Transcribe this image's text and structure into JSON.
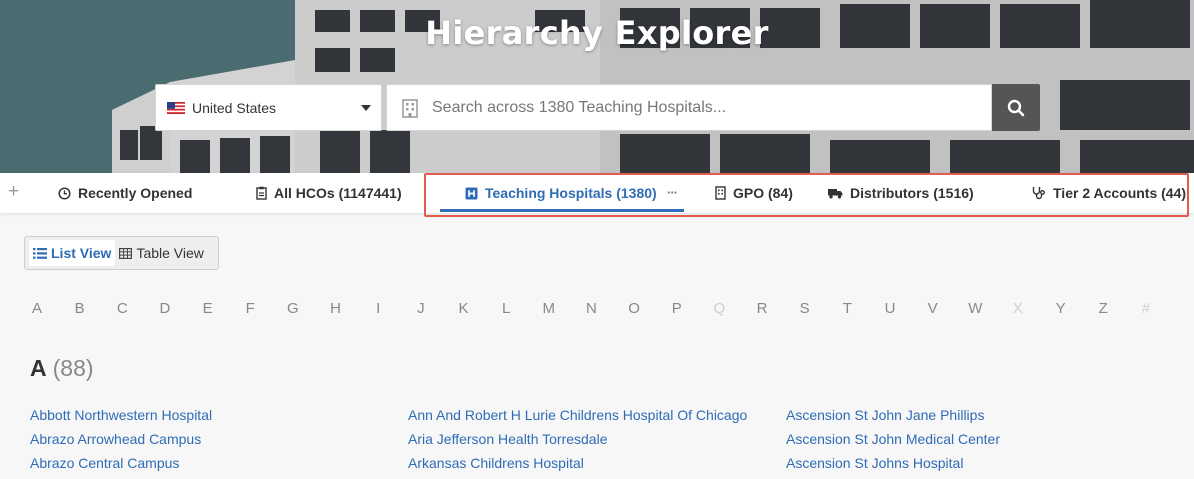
{
  "header": {
    "title": "Hierarchy Explorer",
    "country": {
      "label": "United States",
      "flag_icon": "us-flag-icon"
    },
    "search": {
      "placeholder": "Search across 1380 Teaching Hospitals..."
    }
  },
  "tabs": [
    {
      "name": "tab-recently-opened",
      "icon": "clock-icon",
      "label": "Recently Opened",
      "active": false
    },
    {
      "name": "tab-all-hcos",
      "icon": "clipboard-icon",
      "label": "All HCOs (1147441)",
      "active": false
    },
    {
      "name": "tab-teaching-hospitals",
      "icon": "hospital-icon",
      "label": "Teaching Hospitals (1380)",
      "active": true
    },
    {
      "name": "tab-gpo",
      "icon": "building-icon",
      "label": "GPO (84)",
      "active": false
    },
    {
      "name": "tab-distributors",
      "icon": "truck-icon",
      "label": "Distributors (1516)",
      "active": false
    },
    {
      "name": "tab-tier-2-accounts",
      "icon": "stethoscope-icon",
      "label": "Tier 2 Accounts (44)",
      "active": false
    }
  ],
  "tab_more": "···",
  "view_toggle": {
    "list_label": "List View",
    "table_label": "Table View",
    "selected": "list"
  },
  "alphabet": [
    {
      "l": "A",
      "enabled": true
    },
    {
      "l": "B",
      "enabled": true
    },
    {
      "l": "C",
      "enabled": true
    },
    {
      "l": "D",
      "enabled": true
    },
    {
      "l": "E",
      "enabled": true
    },
    {
      "l": "F",
      "enabled": true
    },
    {
      "l": "G",
      "enabled": true
    },
    {
      "l": "H",
      "enabled": true
    },
    {
      "l": "I",
      "enabled": true
    },
    {
      "l": "J",
      "enabled": true
    },
    {
      "l": "K",
      "enabled": true
    },
    {
      "l": "L",
      "enabled": true
    },
    {
      "l": "M",
      "enabled": true
    },
    {
      "l": "N",
      "enabled": true
    },
    {
      "l": "O",
      "enabled": true
    },
    {
      "l": "P",
      "enabled": true
    },
    {
      "l": "Q",
      "enabled": false
    },
    {
      "l": "R",
      "enabled": true
    },
    {
      "l": "S",
      "enabled": true
    },
    {
      "l": "T",
      "enabled": true
    },
    {
      "l": "U",
      "enabled": true
    },
    {
      "l": "V",
      "enabled": true
    },
    {
      "l": "W",
      "enabled": true
    },
    {
      "l": "X",
      "enabled": false
    },
    {
      "l": "Y",
      "enabled": true
    },
    {
      "l": "Z",
      "enabled": true
    },
    {
      "l": "#",
      "enabled": false
    }
  ],
  "section": {
    "letter": "A",
    "count": "(88)"
  },
  "hospitals": [
    [
      "Abbott Northwestern Hospital",
      "Abrazo Arrowhead Campus",
      "Abrazo Central Campus"
    ],
    [
      "Ann And Robert H Lurie Childrens Hospital Of Chicago",
      "Aria Jefferson Health Torresdale",
      "Arkansas Childrens Hospital"
    ],
    [
      "Ascension St John Jane Phillips",
      "Ascension St John Medical Center",
      "Ascension St Johns Hospital"
    ]
  ],
  "colors": {
    "accent": "#2f6cb5",
    "highlight": "#e25b4f"
  }
}
